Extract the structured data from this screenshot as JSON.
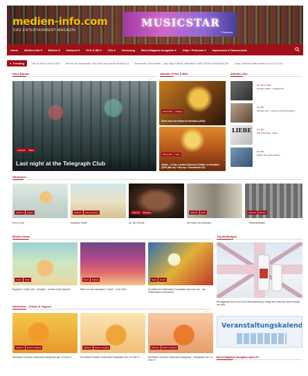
{
  "header": {
    "logo": "medien-info.com",
    "tagline": "DAS ENTERTAINMENT-MAGAZIN",
    "banner_title": "MUSICSTAR",
    "banner_sub": "Premium"
  },
  "nav": {
    "items": [
      "Home",
      "Medien-Info ▾",
      "Bücher ▾",
      "Hörbuch ▾",
      "DVD & BD ▾",
      "CDs ▾",
      "Verlosung",
      "Buch-Magazin Ausgaben ▾",
      "Clips / Podcasts ▾",
      "Impressum & Datenschutz"
    ]
  },
  "ticker": {
    "label": "Trending",
    "items": [
      "Über zu Brian Conrad 2024",
      "Wer von der Kooperation Tier Show aus unserer Wedkend-Tr",
      "Brennender Sonnenbrille – Jean Hugo's Album \"Blendwerk\" WIRD NEUE MUSIKALISCHE",
      "Unser Gewinner liefert diesen A an 10.02.2024"
    ]
  },
  "sections": {
    "neue_buecher": "Neue Bücher",
    "aktuelle_dvds": "Aktuelle DVDs & BDs",
    "aktuelle_cds": "Aktuelle CDs",
    "hoerbuecher": "Hörbücher",
    "medien_news": "Medien News",
    "top_meldungen": "Top Meldungen",
    "hoerbuecher_kinder": "Hörbücher - Kinder & Jugend",
    "buch_magazin": "Buch-Magazin Ausgabe April 22"
  },
  "hero": {
    "tags": [
      "Fotobuch",
      "Bilder"
    ],
    "title": "Last night at the Telegraph Club"
  },
  "dvd_items": [
    {
      "tags": [
        "DVD & BD",
        "Filmtipp"
      ],
      "title": "Dieter from the Future im Heimkino (2023)"
    },
    {
      "tags": [
        "DVD & BD",
        "Serie"
      ],
      "title": "Wickie – 4-Disc Limited Collector's Edition im Heimkino (2023 (Blu-ray + Blu-ray + Soundtrack-CD)"
    }
  ],
  "cd_items": [
    {
      "cat": "CD, Neue Single",
      "title": "Ruwaya: Wells – Angekommt"
    },
    {
      "cat": "CD, Bild",
      "title": "Höchste Zeit – Liebe ist verrückt (Liebes)"
    },
    {
      "cat": "CD, Bild",
      "title": "Nils & Schraub - Liebe"
    },
    {
      "cat": "CD, Bild",
      "title": "Werbe-Pur-Ordner Album"
    }
  ],
  "hoerbuecher": [
    {
      "tags": [
        "Hörbuch",
        "Jugend"
      ],
      "title": "Erst & So Ip"
    },
    {
      "tags": [
        "Hörbuch",
        "Science-Fiction"
      ],
      "title": "Komische Kinder"
    },
    {
      "tags": [
        "Hörbuch",
        "Biografie"
      ],
      "title": "Ich, der Fremde"
    },
    {
      "tags": [
        "Hörbuch",
        "Krimi"
      ],
      "title": "Die Kinder von Bruxelles"
    },
    {
      "tags": [
        "Hörbuch",
        "Roman"
      ],
      "title": "Weihnachtsbäre"
    }
  ],
  "news": [
    {
      "tags": [
        "Comic",
        "News"
      ],
      "title": "Raphael & Christi: 300 – Schabra – Im Rest of the Scheme"
    },
    {
      "tags": [
        "News",
        "Klassik"
      ],
      "title": "Bilanz zur der Nobelpreis: \"Cobra\" – Kino 2024"
    },
    {
      "tags": [
        "News",
        "Comic"
      ],
      "title": "Donaldtier der Weiterlesen Donaldfans wird auch auf ...der Entenhausen Geschichten"
    }
  ],
  "top": {
    "title": "Mit taggesatt Euro? nein 2023 Neuentwicklung in erfolgt zum Szenario Jahres-Bumpf aus dem"
  },
  "kids": [
    {
      "tags": [
        "Hörbuch",
        "Kinder & Jugend"
      ],
      "title": "Die kleinen Draußen Kidsomedia Storgeisler aus \"Ur Kirch 3\""
    },
    {
      "tags": [
        "Hörbuch",
        "Kinder & Jugend"
      ],
      "title": "Die kleinen Draußen Kidsomedia Storgeisler aus \"Ur Kirch 4\""
    },
    {
      "tags": [
        "Hörbuch",
        "Kinder & Jugend"
      ],
      "title": "Die kleinen Draußen Kidsomedia Storgeisler – Storgeisler aus \"Ur Kirch 5\""
    }
  ],
  "veranstaltung": "Veranstaltungskalender"
}
